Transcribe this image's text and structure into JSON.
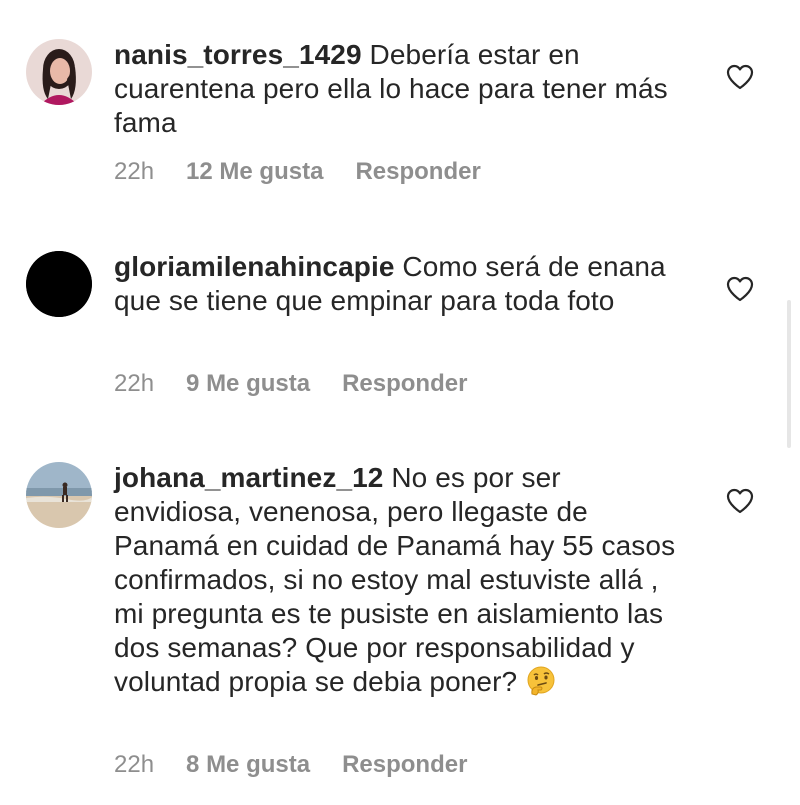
{
  "comments": [
    {
      "username": "nanis_torres_1429",
      "text": "Debería estar en cuarentena pero ella lo hace para tener más fama",
      "time": "22h",
      "likes": "12 Me gusta",
      "reply": "Responder",
      "avatar_icon": "profile-photo-icon"
    },
    {
      "username": "gloriamilenahincapie",
      "text": "Como será de enana que se tiene que empinar para toda foto",
      "time": "22h",
      "likes": "9 Me gusta",
      "reply": "Responder",
      "avatar_icon": "black-avatar-icon"
    },
    {
      "username": "johana_martinez_12",
      "text": "No es por ser envidiosa,  venenosa,  pero llegaste de Panamá en cuidad de Panamá hay 55 casos confirmados,  si no estoy mal estuviste allá ,  mi pregunta es  te pusiste en aislamiento las dos semanas? Que por responsabilidad y voluntad propia se debia poner?",
      "emoji": "thinking-face-emoji",
      "time": "22h",
      "likes": "8 Me gusta",
      "reply": "Responder",
      "avatar_icon": "beach-photo-icon"
    }
  ],
  "colors": {
    "text": "#262626",
    "meta": "#8e8e8e",
    "heart_stroke": "#262626"
  }
}
